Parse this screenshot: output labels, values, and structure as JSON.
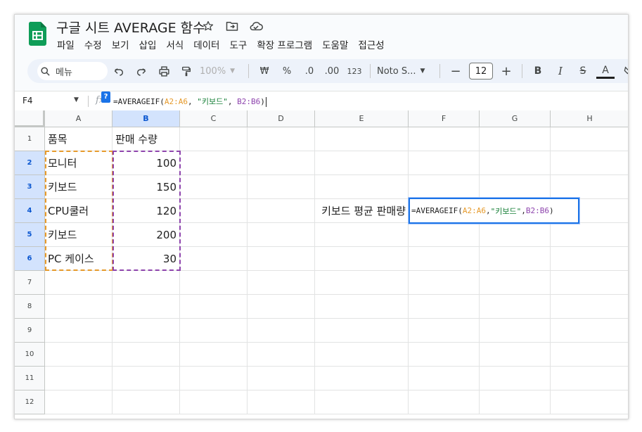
{
  "app": {
    "doc_title": "구글 시트 AVERAGE 함수",
    "colors": {
      "accent": "#1a73e8",
      "range_a": "#e69a2b",
      "range_b": "#8e44ad",
      "string": "#188038",
      "logo": "#0f9d58"
    }
  },
  "menu": [
    "파일",
    "수정",
    "보기",
    "삽입",
    "서식",
    "데이터",
    "도구",
    "확장 프로그램",
    "도움말",
    "접근성"
  ],
  "toolbar": {
    "search_label": "메뉴",
    "zoom": "100%",
    "currency": "₩",
    "percent": "%",
    "dec_decrease": ".0",
    "dec_increase": ".00",
    "number_format": "123",
    "font": "Noto S...",
    "font_size": "12",
    "minus": "−",
    "plus": "+",
    "bold": "B",
    "italic": "I",
    "strike": "S",
    "text_color": "A"
  },
  "formula_bar": {
    "name_box": "F4",
    "fx": "fx",
    "help": "?",
    "formula_parts": {
      "head": "=AVERAGEIF(",
      "range_a": "A2:A6",
      "sep1": ", ",
      "criteria": "\"키보드\"",
      "sep2": ", ",
      "range_b": "B2:B6",
      "tail": ")"
    }
  },
  "sheet": {
    "columns": [
      "A",
      "B",
      "C",
      "D",
      "E",
      "F",
      "G",
      "H"
    ],
    "selected_column": "B",
    "rows": [
      "1",
      "2",
      "3",
      "4",
      "5",
      "6",
      "7",
      "8",
      "9",
      "10",
      "11",
      "12"
    ],
    "data": [
      [
        "품목",
        "판매 수량"
      ],
      [
        "모니터",
        "100"
      ],
      [
        "키보드",
        "150"
      ],
      [
        "CPU쿨러",
        "120"
      ],
      [
        "키보드",
        "200"
      ],
      [
        "PC 케이스",
        "30"
      ]
    ],
    "label_cell": {
      "ref": "E4",
      "text": "키보드 평균 판매량"
    },
    "active_cell": "F4"
  }
}
